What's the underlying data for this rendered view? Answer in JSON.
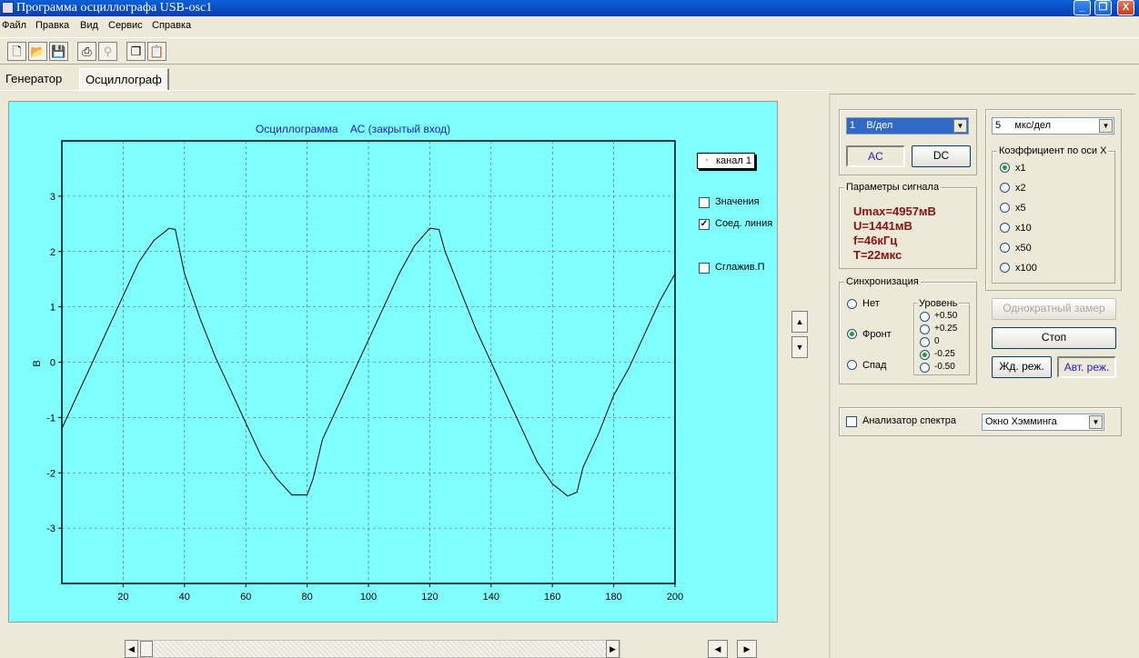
{
  "window": {
    "title": "Программа осциллографа USB-osc1",
    "buttons": [
      "_",
      "❐",
      "X"
    ]
  },
  "menu": [
    "Файл",
    "Правка",
    "Вид",
    "Сервис",
    "Справка"
  ],
  "toolbar": {
    "icons": [
      "new-file-icon",
      "open-folder-icon",
      "save-icon",
      "print-icon",
      "find-icon",
      "copy-icon",
      "paste-icon"
    ]
  },
  "tabs": [
    "Генератор",
    "Осциллограф"
  ],
  "chart": {
    "title": "Осциллограмма    АС (закрытый вход)",
    "legend_label": "канал 1",
    "options": {
      "values": {
        "label": "Значения",
        "checked": false
      },
      "connect": {
        "label": "Соед. линия",
        "checked": true
      },
      "smooth": {
        "label": "Сглажив.П",
        "checked": false
      }
    }
  },
  "chart_data": {
    "type": "line",
    "xlabel": "",
    "ylabel": "В",
    "xlim": [
      0,
      200
    ],
    "ylim": [
      -4,
      4
    ],
    "xticks": [
      20,
      40,
      60,
      80,
      100,
      120,
      140,
      160,
      180,
      200
    ],
    "yticks": [
      -3,
      -2,
      -1,
      0,
      1,
      2,
      3
    ],
    "grid": true,
    "series": [
      {
        "name": "канал 1",
        "x": [
          0,
          5,
          10,
          15,
          20,
          25,
          30,
          35,
          37,
          40,
          45,
          50,
          55,
          60,
          65,
          70,
          75,
          80,
          82,
          85,
          90,
          95,
          100,
          105,
          110,
          115,
          120,
          123,
          125,
          130,
          135,
          140,
          145,
          150,
          155,
          160,
          165,
          168,
          170,
          175,
          180,
          185,
          190,
          195,
          200
        ],
        "y": [
          -1.2,
          -0.6,
          0.0,
          0.6,
          1.2,
          1.8,
          2.2,
          2.42,
          2.4,
          1.6,
          0.8,
          0.1,
          -0.5,
          -1.1,
          -1.7,
          -2.1,
          -2.4,
          -2.4,
          -2.1,
          -1.4,
          -0.8,
          -0.2,
          0.4,
          1.0,
          1.6,
          2.1,
          2.42,
          2.4,
          2.0,
          1.3,
          0.6,
          0.0,
          -0.6,
          -1.2,
          -1.8,
          -2.2,
          -2.42,
          -2.35,
          -1.9,
          -1.3,
          -0.6,
          -0.1,
          0.5,
          1.1,
          1.6
        ]
      }
    ]
  },
  "controls": {
    "volts_per_div": "1    В/дел",
    "coupling": {
      "ac": "AC",
      "dc": "DC"
    },
    "time_per_div": "5     мкс/дел",
    "x_coeff_title": "Коэффициент по оси X",
    "x_coeff_options": [
      "x1",
      "x2",
      "x5",
      "x10",
      "x50",
      "x100"
    ],
    "x_coeff_selected": "x1",
    "params_title": "Параметры сигнала",
    "params": [
      "Umax=4957мВ",
      "U=1441мВ",
      "f=46кГц",
      "T=22мкс"
    ],
    "sync_title": "Синхронизация",
    "sync_options": [
      "Нет",
      "Фронт",
      "Спад"
    ],
    "sync_selected": "Фронт",
    "level_title": "Уровень",
    "level_options": [
      "+0.50",
      "+0.25",
      "0",
      "-0.25",
      "-0.50"
    ],
    "level_selected": "-0.25",
    "single_shot": "Однократный замер",
    "stop": "Стоп",
    "wait_mode": "Жд. реж.",
    "auto_mode": "Авт. реж.",
    "spectrum_label": "Анализатор спектра",
    "window_select": "Окно Хэмминга"
  }
}
